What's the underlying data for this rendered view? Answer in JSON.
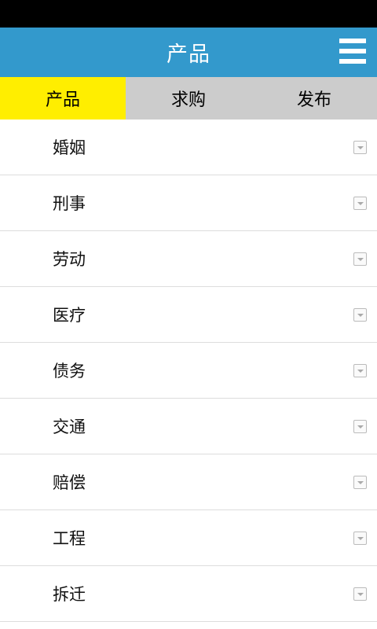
{
  "header": {
    "title": "产品",
    "menu_icon": "menu-icon"
  },
  "tabs": [
    {
      "label": "产品",
      "active": true
    },
    {
      "label": "求购",
      "active": false
    },
    {
      "label": "发布",
      "active": false
    }
  ],
  "list": {
    "expand_icon": "dropdown-arrow-icon",
    "items": [
      {
        "label": "婚姻"
      },
      {
        "label": "刑事"
      },
      {
        "label": "劳动"
      },
      {
        "label": "医疗"
      },
      {
        "label": "债务"
      },
      {
        "label": "交通"
      },
      {
        "label": "赔偿"
      },
      {
        "label": "工程"
      },
      {
        "label": "拆迁"
      }
    ]
  },
  "colors": {
    "header_bg": "#3399cc",
    "active_tab_bg": "#ffee00",
    "tab_bar_bg": "#cccccc",
    "status_bar_bg": "#000000"
  }
}
